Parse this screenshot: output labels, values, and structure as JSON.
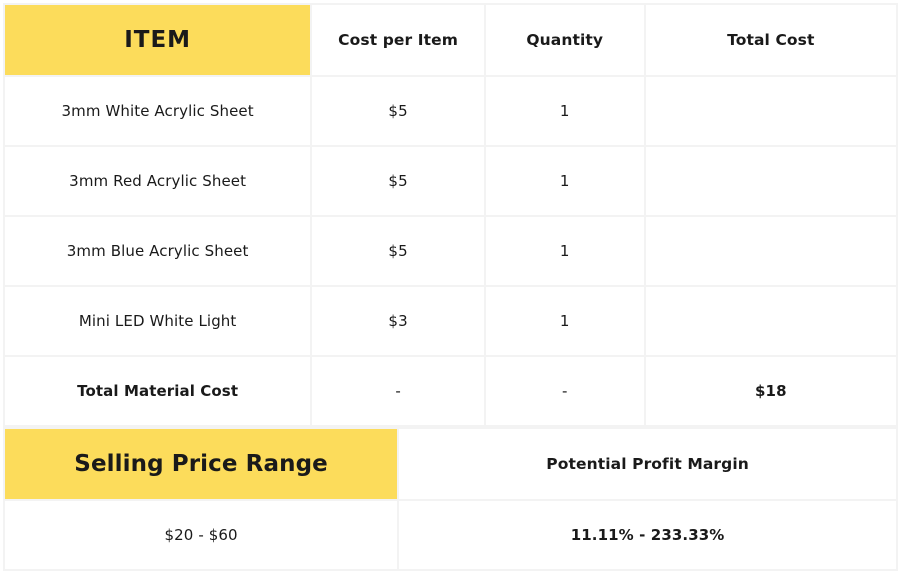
{
  "materials": {
    "headers": {
      "item": "ITEM",
      "cost": "Cost per Item",
      "quantity": "Quantity",
      "total": "Total Cost"
    },
    "rows": [
      {
        "item": "3mm White Acrylic Sheet",
        "cost": "$5",
        "quantity": "1",
        "total": ""
      },
      {
        "item": "3mm Red Acrylic Sheet",
        "cost": "$5",
        "quantity": "1",
        "total": ""
      },
      {
        "item": "3mm Blue Acrylic Sheet",
        "cost": "$5",
        "quantity": "1",
        "total": ""
      },
      {
        "item": "Mini LED White Light",
        "cost": "$3",
        "quantity": "1",
        "total": ""
      }
    ],
    "total_row": {
      "label": "Total Material Cost",
      "cost": "-",
      "quantity": "-",
      "total": "$18"
    }
  },
  "pricing": {
    "selling_header": "Selling Price Range",
    "profit_header": "Potential Profit Margin",
    "selling_value": "$20 - $60",
    "profit_value": "11.11% - 233.33%"
  },
  "colors": {
    "accent_yellow": "#fcdc5b",
    "grid_line": "#f3f3f3"
  }
}
